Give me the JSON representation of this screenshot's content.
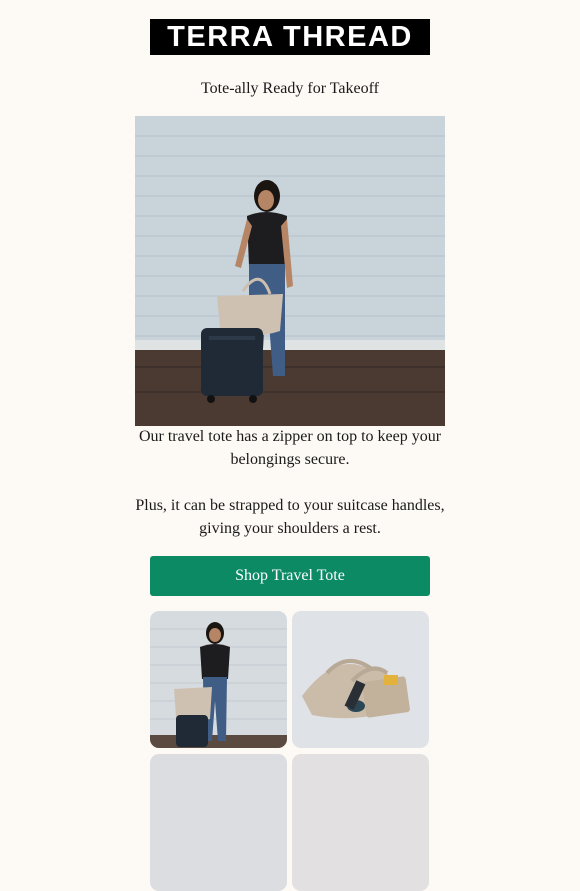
{
  "brand": {
    "logo_text": "TERRA THREAD"
  },
  "headline": "Tote-ally Ready for Takeoff",
  "hero": {
    "image_icon": "woman-with-suitcase-and-tote-photo"
  },
  "body": {
    "paragraph1_line1": "Our travel tote has a zipper on top to keep your",
    "paragraph1_line2": "belongings secure.",
    "paragraph2_line1": "Plus, it can be strapped to your suitcase handles,",
    "paragraph2_line2": "giving your shoulders a rest."
  },
  "cta": {
    "label": "Shop Travel Tote",
    "color": "#0b8a64"
  },
  "gallery": [
    {
      "icon": "woman-with-tote-photo"
    },
    {
      "icon": "tote-bag-product-photo"
    },
    {
      "icon": "product-photo-partial"
    },
    {
      "icon": "product-photo-partial"
    }
  ],
  "colors": {
    "background": "#fdf9f5",
    "logo_bg": "#000000",
    "accent": "#0b8a64"
  }
}
